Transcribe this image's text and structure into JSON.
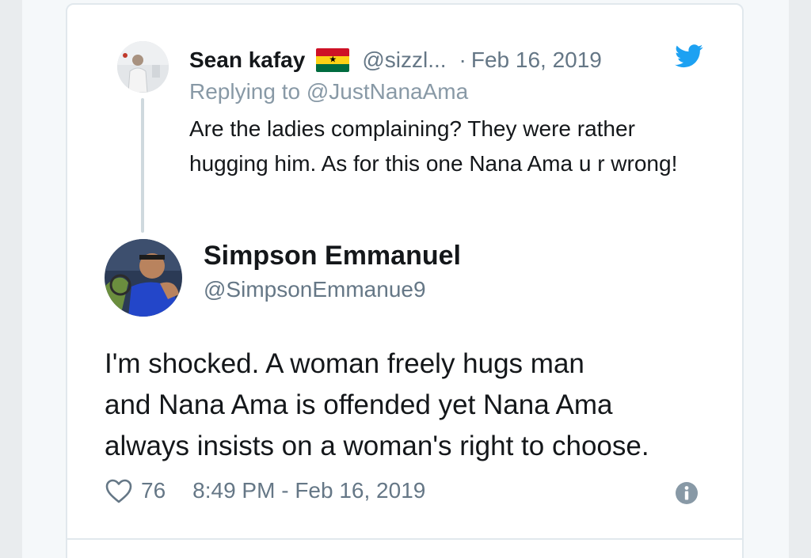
{
  "reply_tweet": {
    "author_name": "Sean kafay",
    "flag": "ghana-flag-emoji",
    "handle": "@sizzl...",
    "separator": "·",
    "date": "Feb 16, 2019",
    "replying_to_prefix": "Replying to ",
    "replying_to_handle": "@JustNanaAma",
    "text": "Are the ladies complaining? They were rather hugging him.  As for this one Nana Ama u r wrong!"
  },
  "main_tweet": {
    "author_name": "Simpson Emmanuel",
    "handle": "@SimpsonEmmanue9",
    "text": "I'm  shocked. A woman freely hugs  man\nand Nana Ama is  offended yet Nana Ama\nalways insists on a woman's right to choose.",
    "like_count": "76",
    "timestamp": "8:49 PM - Feb 16, 2019"
  },
  "icons": {
    "brand": "twitter-bird-icon",
    "like": "heart-icon",
    "info": "info-icon"
  },
  "colors": {
    "twitter_blue": "#1da1f2",
    "text_primary": "#14171a",
    "text_secondary": "#657786",
    "border": "#e1e8ed",
    "ghana_red": "#ce1126",
    "ghana_gold": "#fcd116",
    "ghana_green": "#006b3f"
  }
}
